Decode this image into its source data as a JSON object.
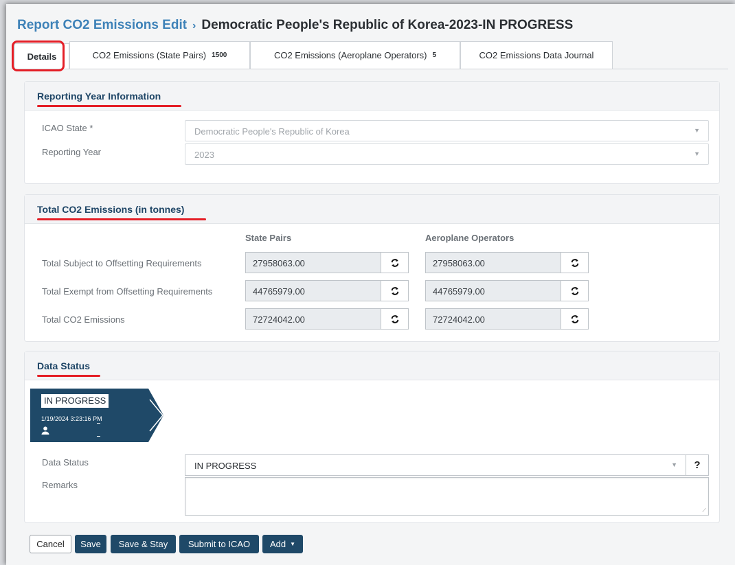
{
  "breadcrumb": {
    "parent": "Report CO2 Emissions Edit",
    "separator": "›",
    "current": "Democratic People's Republic of Korea-2023-IN PROGRESS"
  },
  "tabs": [
    {
      "label": "Details",
      "count": ""
    },
    {
      "label": "CO2 Emissions (State Pairs)",
      "count": "1500"
    },
    {
      "label": "CO2 Emissions (Aeroplane Operators)",
      "count": "5"
    },
    {
      "label": "CO2 Emissions Data Journal",
      "count": ""
    }
  ],
  "active_tab": "Details",
  "reporting_year": {
    "title": "Reporting Year Information",
    "state_label": "ICAO State *",
    "state_value": "Democratic People's Republic of Korea",
    "year_label": "Reporting Year",
    "year_value": "2023"
  },
  "totals": {
    "title": "Total CO2 Emissions (in tonnes)",
    "col_state_pairs": "State Pairs",
    "col_aeroplane_operators": "Aeroplane Operators",
    "rows": [
      {
        "label": "Total Subject to Offsetting Requirements",
        "state_pairs": "27958063.00",
        "aeroplane_operators": "27958063.00"
      },
      {
        "label": "Total Exempt from Offsetting Requirements",
        "state_pairs": "44765979.00",
        "aeroplane_operators": "44765979.00"
      },
      {
        "label": "Total CO2 Emissions",
        "state_pairs": "72724042.00",
        "aeroplane_operators": "72724042.00"
      }
    ]
  },
  "data_status": {
    "title": "Data Status",
    "card_status": "IN PROGRESS",
    "card_timestamp": "1/19/2024 3:23:16 PM",
    "status_label": "Data Status",
    "status_value": "IN PROGRESS",
    "help": "?",
    "remarks_label": "Remarks",
    "remarks_value": ""
  },
  "actions": {
    "cancel": "Cancel",
    "save": "Save",
    "save_stay": "Save & Stay",
    "submit": "Submit to ICAO",
    "add": "Add"
  },
  "colors": {
    "accent_dark": "#1f4968",
    "link": "#3e82b8",
    "annotation_red": "#e41e26"
  }
}
